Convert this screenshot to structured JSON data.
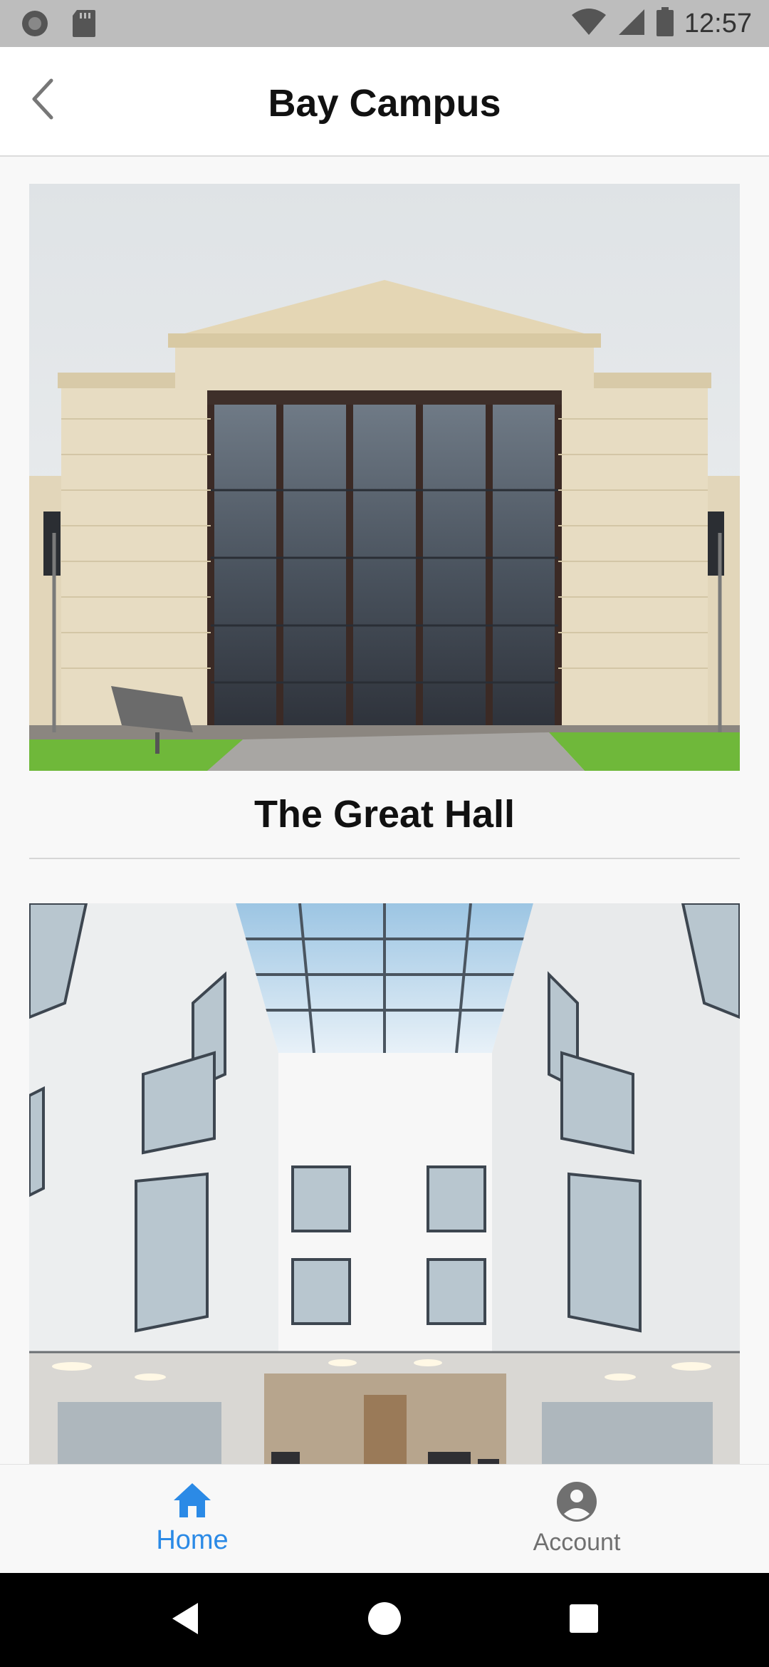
{
  "status_bar": {
    "time": "12:57",
    "left_icons": [
      "circle-notification-icon",
      "sd-card-icon"
    ],
    "right_icons": [
      "wifi-icon",
      "cell-signal-icon",
      "battery-icon"
    ]
  },
  "header": {
    "title": "Bay Campus",
    "back_icon": "chevron-left-icon"
  },
  "cards": [
    {
      "title": "The Great Hall",
      "image": "great-hall-exterior-photo"
    },
    {
      "title": "",
      "image": "atrium-interior-photo"
    }
  ],
  "tabs": [
    {
      "label": "Home",
      "icon": "home-icon",
      "active": true
    },
    {
      "label": "Account",
      "icon": "account-circle-icon",
      "active": false
    }
  ],
  "colors": {
    "accent": "#2b8ae6",
    "inactive": "#707070",
    "status_bar": "#bdbdbd",
    "header_bg": "#ffffff",
    "page_bg": "#f8f8f8",
    "nav_bar": "#000000"
  }
}
